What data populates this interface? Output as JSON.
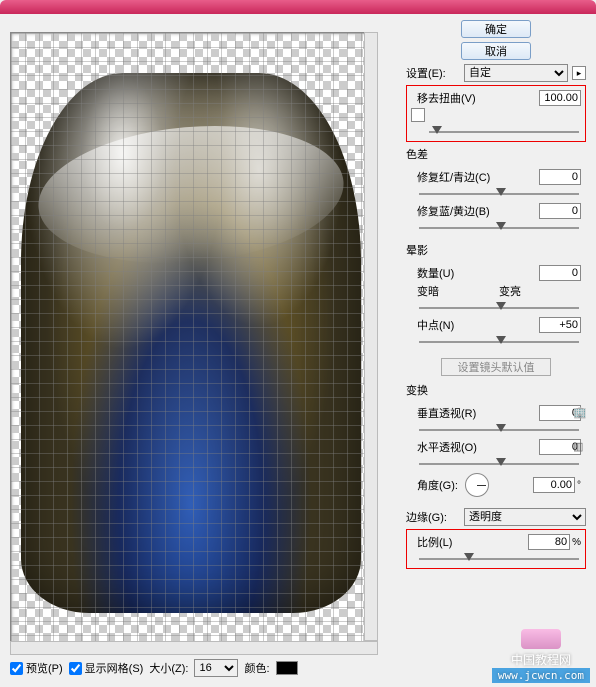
{
  "buttons": {
    "ok": "确定",
    "cancel": "取消"
  },
  "settings": {
    "label": "设置(E):",
    "value": "自定"
  },
  "remove_distortion": {
    "label": "移去扭曲(V)",
    "value": "100.00"
  },
  "chromatic": {
    "title": "色差",
    "red_cyan": {
      "label": "修复红/青边(C)",
      "value": "0"
    },
    "blue_yellow": {
      "label": "修复蓝/黄边(B)",
      "value": "0"
    }
  },
  "vignette": {
    "title": "晕影",
    "amount": {
      "label": "数量(U)",
      "value": "0"
    },
    "dark_light": {
      "dark": "变暗",
      "light": "变亮"
    },
    "midpoint": {
      "label": "中点(N)",
      "value": "+50"
    }
  },
  "lens_default_btn": "设置镜头默认值",
  "transform": {
    "title": "变换",
    "v_persp": {
      "label": "垂直透视(R)",
      "value": "0"
    },
    "h_persp": {
      "label": "水平透视(O)",
      "value": "0"
    },
    "angle": {
      "label": "角度(G):",
      "value": "0.00"
    },
    "edge": {
      "label": "边缘(G):",
      "value": "透明度"
    },
    "scale": {
      "label": "比例(L)",
      "value": "80",
      "unit": "%"
    }
  },
  "footer": {
    "preview": "预览(P)",
    "show_grid": "显示网格(S)",
    "size": "大小(Z):",
    "size_value": "16",
    "color": "颜色:"
  },
  "watermark": {
    "site": "中国教程网",
    "url": "www.jcwcn.com"
  }
}
